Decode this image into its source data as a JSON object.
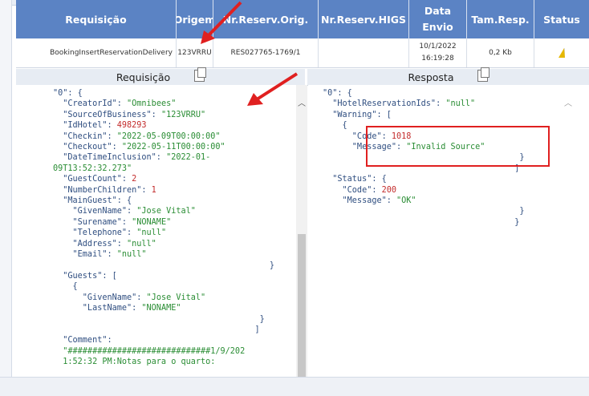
{
  "header": {
    "col_requisicao": "Requisição",
    "col_origem": "Origem",
    "col_nr_reserv_orig": "Nr.Reserv.Orig.",
    "col_nr_reserv_higs": "Nr.Reserv.HIGS",
    "col_data_envio_line1": "Data",
    "col_data_envio_line2": "Envio",
    "col_tam_resp": "Tam.Resp.",
    "col_status": "Status"
  },
  "row": {
    "requisicao": "BookingInsertReservationDelivery",
    "origem": "123VRRU",
    "nr_reserv_orig": "RES027765-1769/1",
    "nr_reserv_higs": "",
    "data_line1": "10/1/2022",
    "data_line2": "16:19:28",
    "tam_resp": "0,2 Kb",
    "status_icon": "warning-icon"
  },
  "panels": {
    "request_title": "Requisição",
    "response_title": "Resposta"
  },
  "request_lines": [
    [
      "p",
      "\"0\": {"
    ],
    [
      "kv",
      "  \"CreatorId\": ",
      "\"Omnibees\"",
      "s"
    ],
    [
      "kv",
      "  \"SourceOfBusiness\": ",
      "\"123VRRU\"",
      "s"
    ],
    [
      "kv",
      "  \"IdHotel\": ",
      "498293",
      "n"
    ],
    [
      "kv",
      "  \"Checkin\": ",
      "\"2022-05-09T00:00:00\"",
      "s"
    ],
    [
      "kv",
      "  \"Checkout\": ",
      "\"2022-05-11T00:00:00\"",
      "s"
    ],
    [
      "kv",
      "  \"DateTimeInclusion\": ",
      "\"2022-01-",
      "s"
    ],
    [
      "p2",
      "",
      "09T13:52:32.273\"",
      "s"
    ],
    [
      "kv",
      "  \"GuestCount\": ",
      "2",
      "n"
    ],
    [
      "kv",
      "  \"NumberChildren\": ",
      "1",
      "n"
    ],
    [
      "p",
      "  \"MainGuest\": {"
    ],
    [
      "kv",
      "    \"GivenName\": ",
      "\"Jose Vital\"",
      "s"
    ],
    [
      "kv",
      "    \"Surename\": ",
      "\"NONAME\"",
      "s"
    ],
    [
      "kv",
      "    \"Telephone\": ",
      "\"null\"",
      "s"
    ],
    [
      "kv",
      "    \"Address\": ",
      "\"null\"",
      "s"
    ],
    [
      "kv",
      "    \"Email\": ",
      "\"null\"",
      "s"
    ],
    [
      "p",
      "                                            }"
    ],
    [
      "p",
      "  \"Guests\": ["
    ],
    [
      "p",
      "    {"
    ],
    [
      "kv",
      "      \"GivenName\": ",
      "\"Jose Vital\"",
      "s"
    ],
    [
      "kv",
      "      \"LastName\": ",
      "\"NONAME\"",
      "s"
    ],
    [
      "p",
      "                                          }"
    ],
    [
      "p",
      "                                         ]"
    ],
    [
      "p",
      "  \"Comment\":"
    ],
    [
      "p2",
      "",
      "  \"#############################1/9/202",
      "s"
    ],
    [
      "p2",
      "",
      "  1:52:32 PM:Notas para o quarto:",
      "s"
    ]
  ],
  "response_lines": [
    [
      "p",
      "\"0\": {"
    ],
    [
      "kv",
      "  \"HotelReservationIds\": ",
      "\"null\"",
      "s"
    ],
    [
      "p",
      "  \"Warning\": ["
    ],
    [
      "p",
      "    {"
    ],
    [
      "kv",
      "      \"Code\": ",
      "1018",
      "n"
    ],
    [
      "kv",
      "      \"Message\": ",
      "\"Invalid Source\"",
      "s"
    ],
    [
      "p",
      "                                        }"
    ],
    [
      "p",
      "                                       ]"
    ],
    [
      "p",
      "  \"Status\": {"
    ],
    [
      "kv",
      "    \"Code\": ",
      "200",
      "n"
    ],
    [
      "kv",
      "    \"Message\": ",
      "\"OK\"",
      "s"
    ],
    [
      "p",
      "                                        }"
    ],
    [
      "p",
      "                                       }"
    ]
  ],
  "colors": {
    "header_bg": "#5b83c4",
    "string": "#2a8d34",
    "number": "#c32c2c",
    "highlight": "#e02020"
  }
}
